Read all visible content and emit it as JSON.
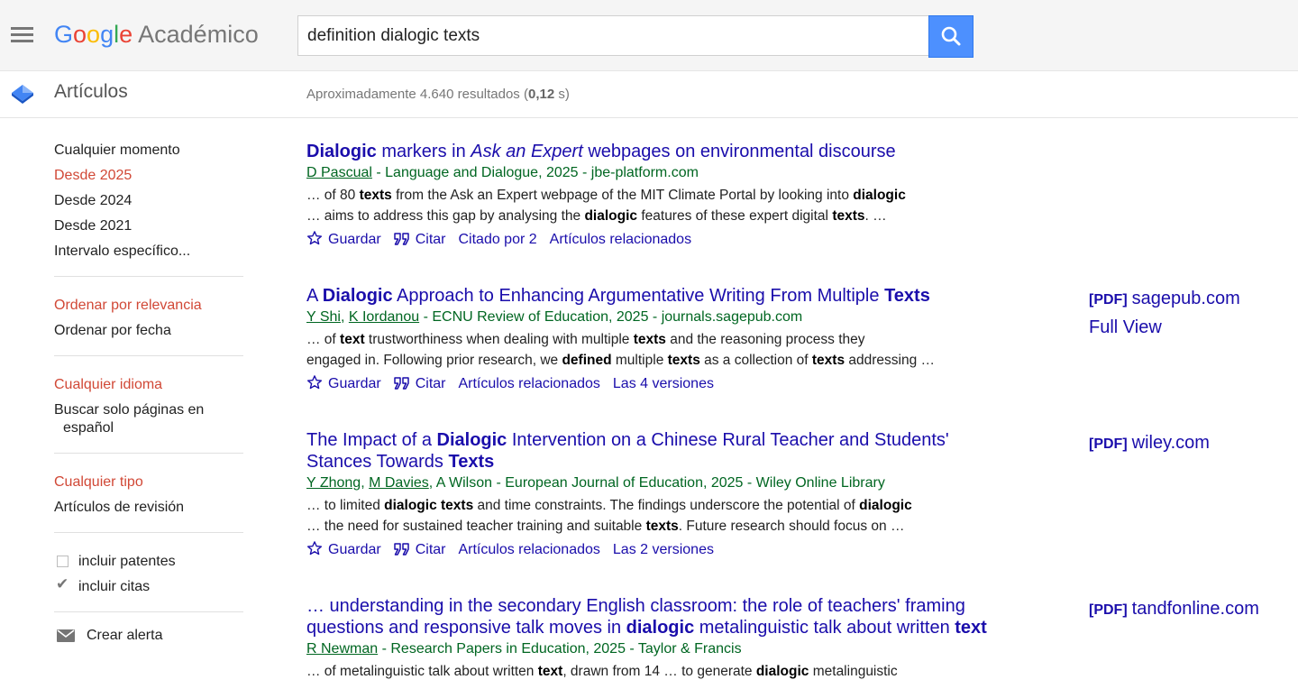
{
  "header": {
    "logo": {
      "g": "G",
      "o1": "o",
      "o2": "o",
      "g2": "g",
      "l": "l",
      "e": "e",
      "product": "Académico"
    },
    "search_value": "definition dialogic texts"
  },
  "subheader": {
    "section": "Artículos",
    "stats_prefix": "Aproximadamente 4.640 resultados (",
    "stats_time": "0,12",
    "stats_suffix": " s)"
  },
  "sidebar": {
    "time": [
      "Cualquier momento",
      "Desde 2025",
      "Desde 2024",
      "Desde 2021",
      "Intervalo específico..."
    ],
    "sort": [
      "Ordenar por relevancia",
      "Ordenar por fecha"
    ],
    "lang_any": "Cualquier idioma",
    "lang_only_1": "Buscar solo páginas en",
    "lang_only_2": "español",
    "type_any": "Cualquier tipo",
    "type_review": "Artículos de revisión",
    "include_patents": "incluir patentes",
    "include_citations": "incluir citas",
    "create_alert": "Crear alerta"
  },
  "results": [
    {
      "title": [
        {
          "b": "Dialogic"
        },
        {
          "t": " markers in "
        },
        {
          "i": "Ask an Expert"
        },
        {
          "t": " webpages on environmental discourse"
        }
      ],
      "authors": [
        "D Pascual"
      ],
      "meta_rest": " - Language and Dialogue, 2025 - jbe-platform.com",
      "snippet": [
        [
          {
            "t": "… of 80 "
          },
          {
            "b": "texts"
          },
          {
            "t": " from the Ask an Expert webpage of the MIT Climate Portal by looking into "
          },
          {
            "b": "dialogic"
          }
        ],
        [
          {
            "t": "… aims to address this gap by analysing the "
          },
          {
            "b": "dialogic"
          },
          {
            "t": " features of these expert digital "
          },
          {
            "b": "texts"
          },
          {
            "t": ". …"
          }
        ]
      ],
      "actions": [
        "Guardar",
        "Citar",
        "Citado por 2",
        "Artículos relacionados"
      ],
      "side": []
    },
    {
      "title": [
        {
          "t": "A "
        },
        {
          "b": "Dialogic"
        },
        {
          "t": " Approach to Enhancing Argumentative Writing From Multiple "
        },
        {
          "b": "Texts"
        }
      ],
      "authors": [
        "Y Shi",
        "K Iordanou"
      ],
      "meta_rest": " - ECNU Review of Education, 2025 - journals.sagepub.com",
      "snippet": [
        [
          {
            "t": "… of "
          },
          {
            "b": "text"
          },
          {
            "t": " trustworthiness when dealing with multiple "
          },
          {
            "b": "texts"
          },
          {
            "t": " and the reasoning process they"
          }
        ],
        [
          {
            "t": "engaged in. Following prior research, we "
          },
          {
            "b": "defined"
          },
          {
            "t": " multiple "
          },
          {
            "b": "texts"
          },
          {
            "t": " as a collection of "
          },
          {
            "b": "texts"
          },
          {
            "t": " addressing …"
          }
        ]
      ],
      "actions": [
        "Guardar",
        "Citar",
        "Artículos relacionados",
        "Las 4 versiones"
      ],
      "side": [
        {
          "pdf": "[PDF]",
          "text": "sagepub.com"
        },
        {
          "pdf": "",
          "text": "Full View"
        }
      ]
    },
    {
      "title": [
        {
          "t": "The Impact of a "
        },
        {
          "b": "Dialogic"
        },
        {
          "t": " Intervention on a Chinese Rural Teacher and Students' Stances Towards "
        },
        {
          "b": "Texts"
        }
      ],
      "authors": [
        "Y Zhong",
        "M Davies"
      ],
      "meta_rest": ", A Wilson - European Journal of Education, 2025 - Wiley Online Library",
      "snippet": [
        [
          {
            "t": "… to limited "
          },
          {
            "b": "dialogic texts"
          },
          {
            "t": " and time constraints. The findings underscore the potential of "
          },
          {
            "b": "dialogic"
          }
        ],
        [
          {
            "t": "… the need for sustained teacher training and suitable "
          },
          {
            "b": "texts"
          },
          {
            "t": ". Future research should focus on …"
          }
        ]
      ],
      "actions": [
        "Guardar",
        "Citar",
        "Artículos relacionados",
        "Las 2 versiones"
      ],
      "side": [
        {
          "pdf": "[PDF]",
          "text": "wiley.com"
        }
      ]
    },
    {
      "title": [
        {
          "t": "… understanding in the secondary English classroom: the role of teachers' framing questions and responsive talk moves in "
        },
        {
          "b": "dialogic"
        },
        {
          "t": " metalinguistic talk about written "
        },
        {
          "b": "text"
        }
      ],
      "authors": [
        "R Newman"
      ],
      "meta_rest": " - Research Papers in Education, 2025 - Taylor & Francis",
      "snippet": [
        [
          {
            "t": "… of metalinguistic talk about written "
          },
          {
            "b": "text"
          },
          {
            "t": ", drawn from 14 … to generate "
          },
          {
            "b": "dialogic"
          },
          {
            "t": " metalinguistic"
          }
        ]
      ],
      "actions": [],
      "side": [
        {
          "pdf": "[PDF]",
          "text": "tandfonline.com"
        }
      ]
    }
  ]
}
